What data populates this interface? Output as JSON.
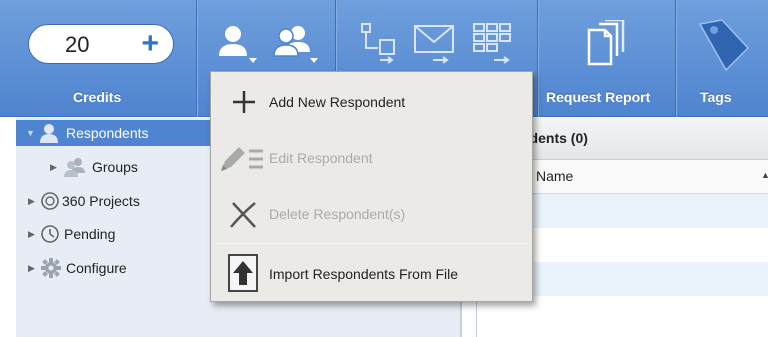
{
  "toolbar": {
    "credits": {
      "value": "20",
      "plus": "+",
      "label": "Credits"
    },
    "request_report_label": "Request Report",
    "tags_label": "Tags"
  },
  "tree": {
    "items": [
      {
        "label": "Respondents"
      },
      {
        "label": "Groups"
      },
      {
        "label": "360 Projects"
      },
      {
        "label": "Pending"
      },
      {
        "label": "Configure"
      }
    ]
  },
  "grid": {
    "title": "ndents (0)",
    "column_name": "Name"
  },
  "menu": {
    "items": [
      {
        "label": "Add New Respondent",
        "enabled": true
      },
      {
        "label": "Edit Respondent",
        "enabled": false
      },
      {
        "label": "Delete Respondent(s)",
        "enabled": false
      },
      {
        "label": "Import Respondents From File",
        "enabled": true
      }
    ]
  },
  "colors": {
    "toolbar_blue": "#4f84cf",
    "selection_blue": "#4e84d0",
    "menu_bg": "#eceae6"
  },
  "icons": [
    "person-icon",
    "people-icon",
    "flow-icon",
    "email-icon",
    "grid-export-icon",
    "documents-icon",
    "tag-icon",
    "plus-icon",
    "pencil-list-icon",
    "x-icon",
    "upload-arrow-icon",
    "gear-icon",
    "clock-icon",
    "circle-arrow-icon"
  ]
}
